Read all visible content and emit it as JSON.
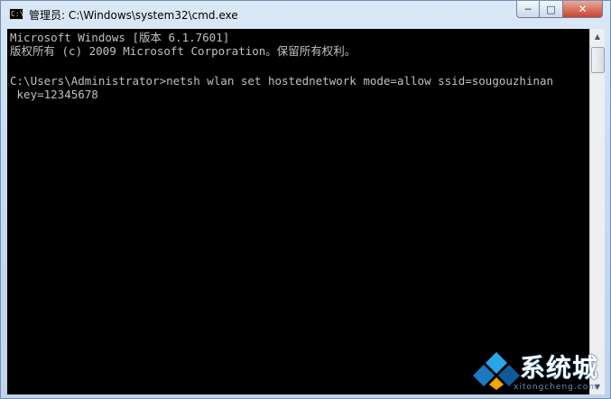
{
  "window": {
    "title": "管理员: C:\\Windows\\system32\\cmd.exe",
    "icon_text": "C:\\"
  },
  "controls": {
    "minimize": "─",
    "maximize": "□",
    "close": "✕"
  },
  "console": {
    "lines": [
      "Microsoft Windows [版本 6.1.7601]",
      "版权所有 (c) 2009 Microsoft Corporation。保留所有权利。",
      "",
      "C:\\Users\\Administrator>netsh wlan set hostednetwork mode=allow ssid=sougouzhinan",
      " key=12345678"
    ]
  },
  "scrollbar": {
    "up": "▲",
    "down": "▼"
  },
  "watermark": {
    "brand": "系统城",
    "url": "xitongcheng.com"
  },
  "colors": {
    "console_bg": "#000000",
    "console_text": "#c0c0c0",
    "close_button": "#c8432c"
  }
}
